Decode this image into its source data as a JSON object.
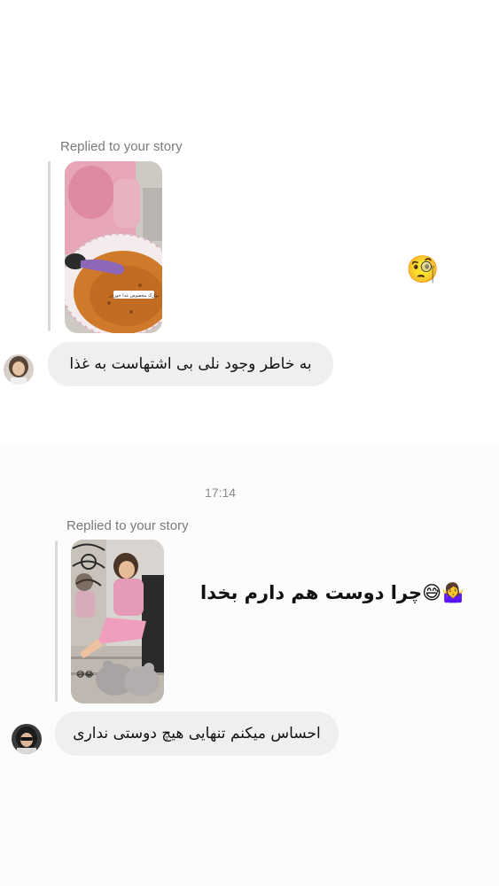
{
  "thread": {
    "message_1": {
      "replied_label": "Replied to your story",
      "story_caption": "نوارک مخصوص غذا خوردن",
      "reaction_emoji": "🧐",
      "text": "به خاطر وجود نلی بی اشتهاست به غذا"
    },
    "timestamp": "17:14",
    "message_2": {
      "replied_label": "Replied to your story",
      "story_sticker": "😅😂",
      "reply_text": "چرا دوست هم دارم بخدا",
      "reply_emojis": "🤷‍♀️😅",
      "text": "احساس میکنم تنهایی هیچ دوستی نداری"
    }
  },
  "colors": {
    "bubble": "#efefef",
    "muted_text": "#7a7a7a",
    "quote_bar": "#d9d9d9"
  }
}
